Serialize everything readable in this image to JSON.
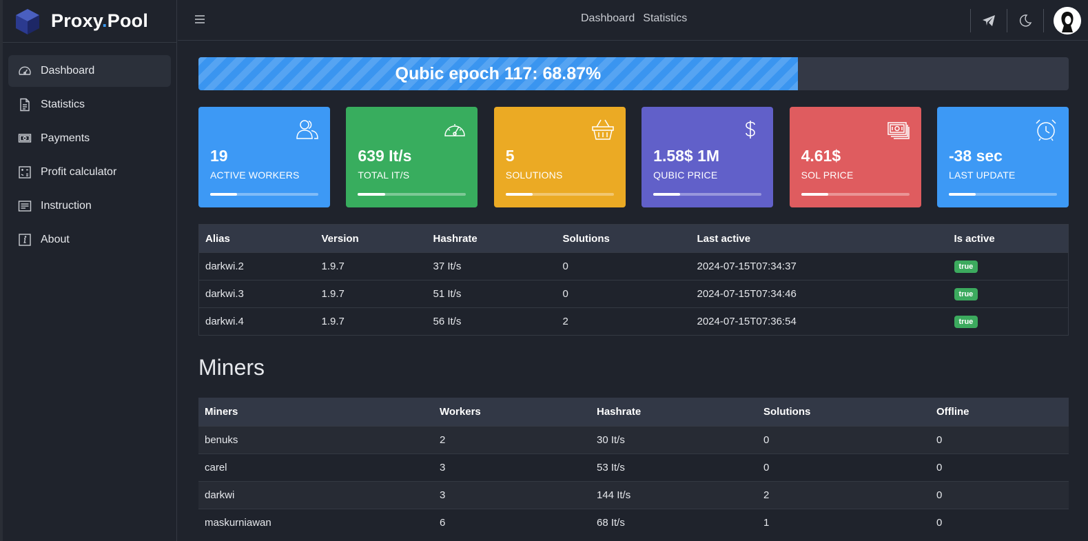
{
  "brand": {
    "name_part1": "Proxy",
    "dot": ".",
    "name_part2": "Pool"
  },
  "sidebar": {
    "items": [
      {
        "label": "Dashboard",
        "icon": "gauge-icon",
        "active": true
      },
      {
        "label": "Statistics",
        "icon": "document-icon"
      },
      {
        "label": "Payments",
        "icon": "cash-icon"
      },
      {
        "label": "Profit calculator",
        "icon": "calculator-icon"
      },
      {
        "label": "Instruction",
        "icon": "list-icon"
      },
      {
        "label": "About",
        "icon": "info-icon"
      }
    ]
  },
  "topbar": {
    "links": [
      "Dashboard",
      "Statistics"
    ],
    "icons": [
      "telegram-icon",
      "moon-icon",
      "avatar-icon"
    ]
  },
  "epoch": {
    "label": "Qubic epoch 117: 68.87%",
    "progress_percent": 68.87,
    "color": "#3a95f0"
  },
  "cards": [
    {
      "value": "19",
      "label": "Active workers",
      "icon": "users-icon",
      "color": "#3d99f5",
      "progress_percent": 25
    },
    {
      "value": "639 It/s",
      "label": "Total It/s",
      "icon": "speedometer-icon",
      "color": "#38ad5e",
      "progress_percent": 25
    },
    {
      "value": "5",
      "label": "Solutions",
      "icon": "basket-icon",
      "color": "#ebaa24",
      "progress_percent": 25
    },
    {
      "value": "1.58$ 1M",
      "label": "Qubic price",
      "icon": "dollar-icon",
      "color": "#6160c9",
      "progress_percent": 25
    },
    {
      "value": "4.61$",
      "label": "SOL price",
      "icon": "cash-icon",
      "color": "#df5c5f",
      "progress_percent": 25
    },
    {
      "value": "-38 sec",
      "label": "Last update",
      "icon": "alarm-icon",
      "color": "#3d99f5",
      "progress_percent": 25
    }
  ],
  "workers_table": {
    "headers": [
      "Alias",
      "Version",
      "Hashrate",
      "Solutions",
      "Last active",
      "Is active"
    ],
    "rows": [
      [
        "darkwi.2",
        "1.9.7",
        "37 It/s",
        "0",
        "2024-07-15T07:34:37",
        "true"
      ],
      [
        "darkwi.3",
        "1.9.7",
        "51 It/s",
        "0",
        "2024-07-15T07:34:46",
        "true"
      ],
      [
        "darkwi.4",
        "1.9.7",
        "56 It/s",
        "2",
        "2024-07-15T07:36:54",
        "true"
      ]
    ]
  },
  "miners_section": {
    "title": "Miners"
  },
  "miners_table": {
    "headers": [
      "Miners",
      "Workers",
      "Hashrate",
      "Solutions",
      "Offline"
    ],
    "rows": [
      [
        "benuks",
        "2",
        "30 It/s",
        "0",
        "0"
      ],
      [
        "carel",
        "3",
        "53 It/s",
        "0",
        "0"
      ],
      [
        "darkwi",
        "3",
        "144 It/s",
        "2",
        "0"
      ],
      [
        "maskurniawan",
        "6",
        "68 It/s",
        "1",
        "0"
      ]
    ]
  }
}
